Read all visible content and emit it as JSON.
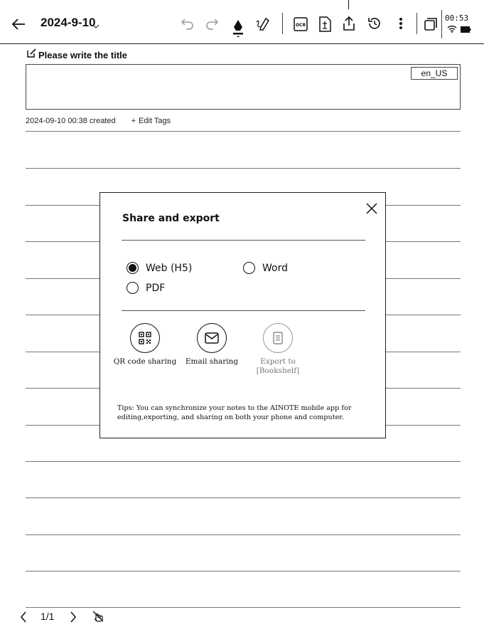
{
  "toolbar": {
    "date": "2024-9-10",
    "clock": "00:53",
    "icons": [
      "back-arrow-icon",
      "chevron-down-icon",
      "undo-icon",
      "redo-icon",
      "pen-icon",
      "eraser-icon",
      "ocr-icon",
      "template-icon",
      "share-icon",
      "history-icon",
      "more-icon",
      "window-icon",
      "wifi-icon",
      "battery-icon"
    ],
    "ocr_label": "OCR"
  },
  "note": {
    "title_placeholder": "Please write the title",
    "language": "en_US",
    "created": "2024-09-10 00:38 created",
    "edit_tags": "Edit Tags",
    "edit_tags_plus": "+"
  },
  "dialog": {
    "title": "Share and export",
    "formats": [
      {
        "label": "Web (H5)",
        "selected": true
      },
      {
        "label": "Word",
        "selected": false
      },
      {
        "label": "PDF",
        "selected": false
      }
    ],
    "share_options": [
      {
        "label": "QR code sharing",
        "icon": "qr-code-icon",
        "enabled": true
      },
      {
        "label": "Email sharing",
        "icon": "email-icon",
        "enabled": true
      },
      {
        "label": "Export to\n[Bookshelf]",
        "line1": "Export to",
        "line2": "[Bookshelf]",
        "icon": "bookshelf-icon",
        "enabled": false
      }
    ],
    "tips": "Tips: You can synchronize your notes to the AINOTE mobile app for editing,exporting, and sharing on both your phone and computer."
  },
  "footer": {
    "page": "1/1"
  }
}
